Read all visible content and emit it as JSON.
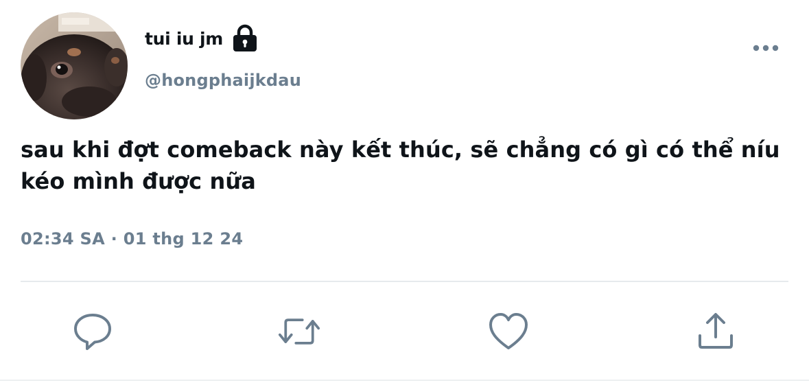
{
  "author": {
    "display_name": "tui iu jm",
    "handle": "@hongphaijkdau",
    "avatar_icon": "avatar-dog-photo",
    "protected_icon": "lock-icon"
  },
  "tweet": {
    "text": "sau khi đợt comeback này kết thúc, sẽ chẳng có gì có thể níu kéo mình được nữa",
    "timestamp": "02:34 SA · 01 thg 12 24"
  },
  "actions": [
    {
      "name": "reply",
      "icon": "reply-icon"
    },
    {
      "name": "retweet",
      "icon": "retweet-icon"
    },
    {
      "name": "like",
      "icon": "heart-icon"
    },
    {
      "name": "share",
      "icon": "share-icon"
    }
  ],
  "colors": {
    "text_primary": "#0f1419",
    "text_secondary": "#6b7e8f",
    "icon": "#6b7e8f",
    "divider": "#e6eaed"
  }
}
